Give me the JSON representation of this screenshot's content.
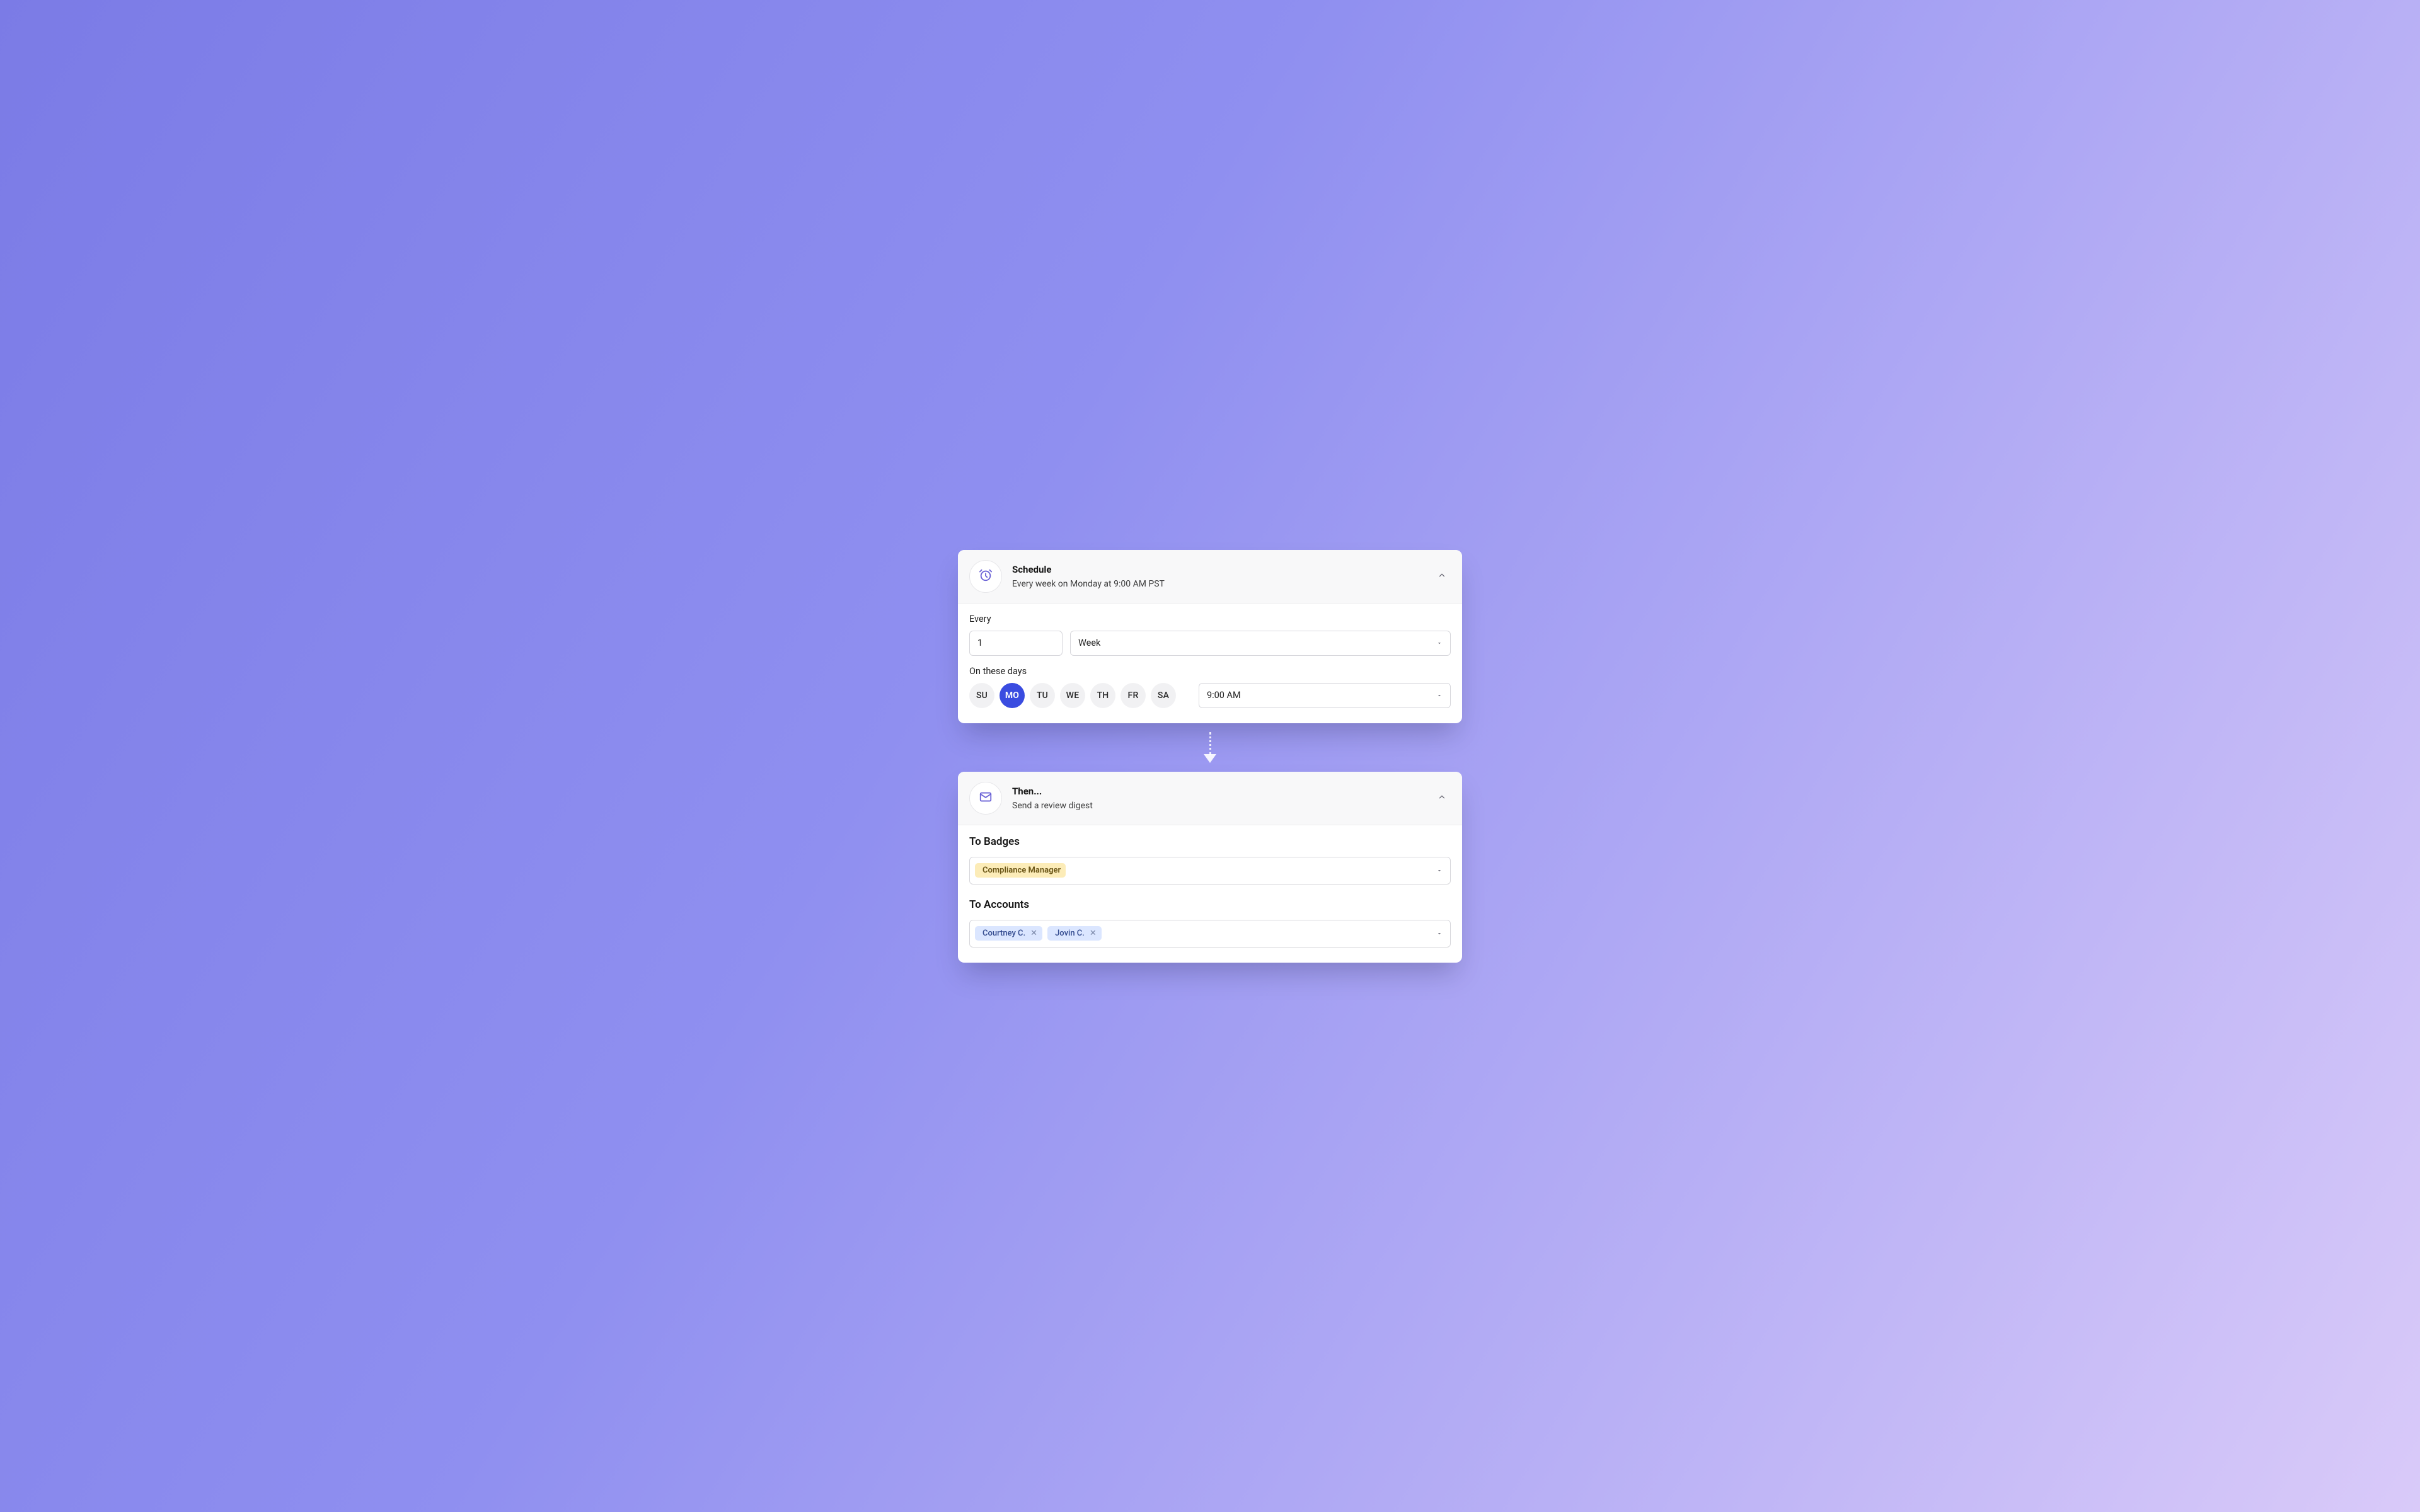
{
  "colors": {
    "accent": "#3a4ce0",
    "icon": "#6b63d6",
    "chip_yellow_bg": "#fcecb8",
    "chip_blue_bg": "#dbe6ff"
  },
  "schedule": {
    "title": "Schedule",
    "subtitle": "Every week on Monday at 9:00 AM PST",
    "every_label": "Every",
    "interval_value": "1",
    "unit_value": "Week",
    "days_label": "On these days",
    "days": [
      "SU",
      "MO",
      "TU",
      "WE",
      "TH",
      "FR",
      "SA"
    ],
    "selected_day_index": 1,
    "time_value": "9:00 AM"
  },
  "then": {
    "title": "Then...",
    "subtitle": "Send a review digest",
    "to_badges_label": "To Badges",
    "badges": [
      "Compliance Manager"
    ],
    "to_accounts_label": "To Accounts",
    "accounts": [
      "Courtney C.",
      "Jovin C."
    ]
  }
}
